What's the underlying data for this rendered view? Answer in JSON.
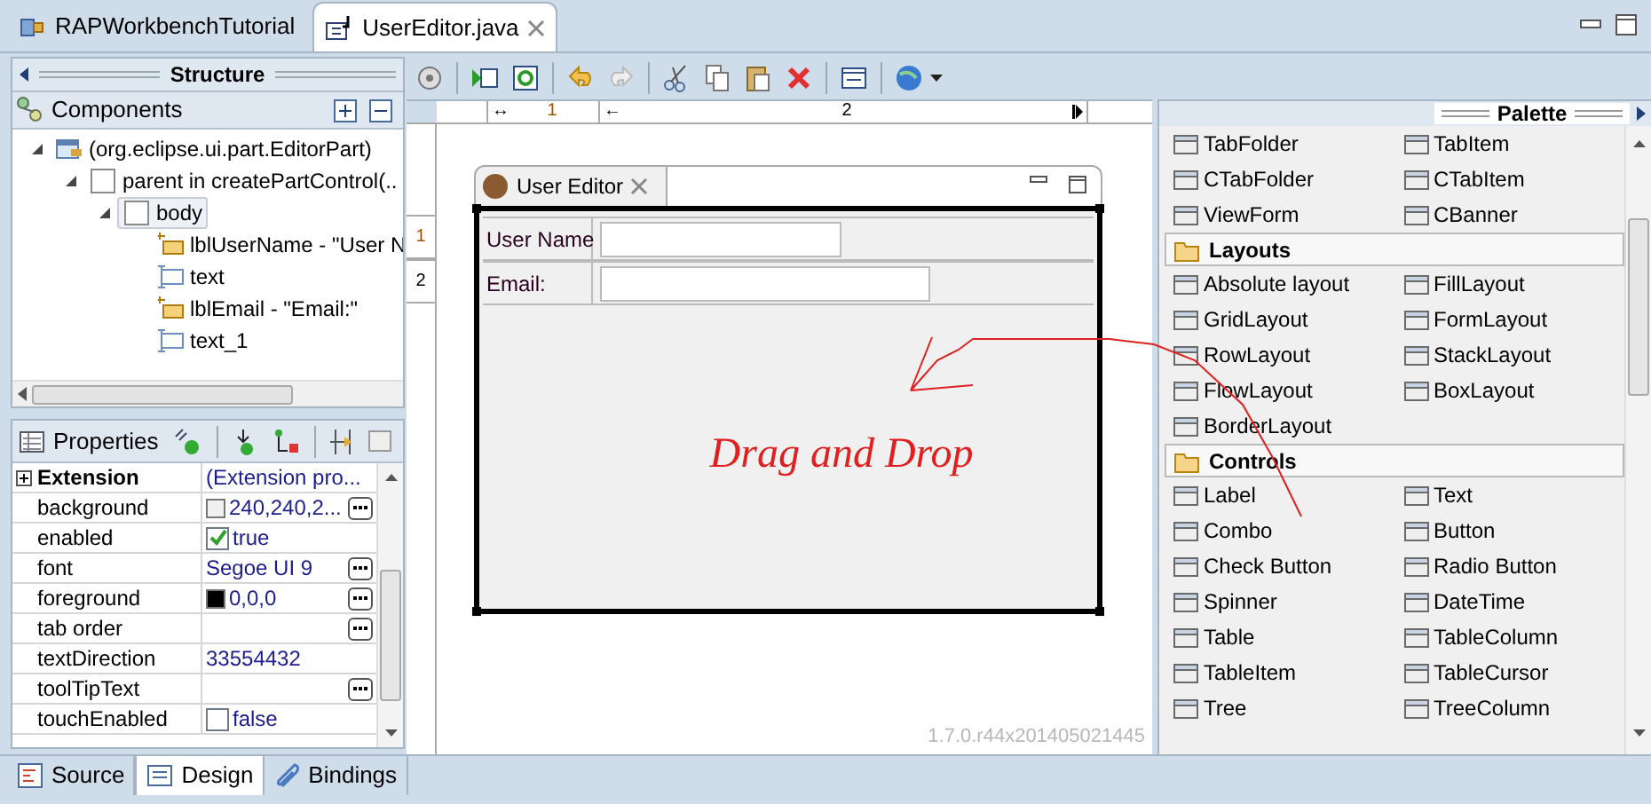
{
  "editor_tabs": [
    {
      "label": "RAPWorkbenchTutorial",
      "selected": false
    },
    {
      "label": "UserEditor.java",
      "selected": true
    }
  ],
  "structure": {
    "title": "Structure"
  },
  "components": {
    "title": "Components",
    "tree": [
      {
        "label": "(org.eclipse.ui.part.EditorPart)",
        "kind": "part",
        "expanded": true,
        "selected": false,
        "children": [
          {
            "label": "parent in createPartControl(..",
            "kind": "composite",
            "expanded": true,
            "selected": false,
            "children": [
              {
                "label": "body",
                "kind": "composite",
                "expanded": true,
                "selected": true,
                "children": [
                  {
                    "label": "lblUserName - \"User N",
                    "kind": "label",
                    "selected": false
                  },
                  {
                    "label": "text",
                    "kind": "text",
                    "selected": false
                  },
                  {
                    "label": "lblEmail - \"Email:\"",
                    "kind": "label",
                    "selected": false
                  },
                  {
                    "label": "text_1",
                    "kind": "text",
                    "selected": false
                  }
                ]
              }
            ]
          }
        ]
      }
    ]
  },
  "properties": {
    "title": "Properties",
    "rows": [
      {
        "name": "Extension",
        "kind": "category",
        "expanded": false,
        "value": "(Extension pro..."
      },
      {
        "name": "background",
        "kind": "color",
        "color": "#f0f0f0",
        "value": "240,240,2...",
        "button": true
      },
      {
        "name": "enabled",
        "kind": "check",
        "checked": true,
        "value": "true"
      },
      {
        "name": "font",
        "kind": "text",
        "value": "Segoe UI 9",
        "button": true
      },
      {
        "name": "foreground",
        "kind": "color",
        "color": "#000000",
        "value": "0,0,0",
        "button": true
      },
      {
        "name": "tab order",
        "kind": "text",
        "button": true
      },
      {
        "name": "textDirection",
        "kind": "text",
        "value": "33554432"
      },
      {
        "name": "toolTipText",
        "kind": "text",
        "button": true
      },
      {
        "name": "touchEnabled",
        "kind": "check",
        "checked": false,
        "value": "false"
      }
    ]
  },
  "ruler": {
    "columns": [
      {
        "label": "1",
        "glyph": "↔"
      },
      {
        "label": "2",
        "glyph": "←"
      }
    ],
    "rows": [
      "1",
      "2"
    ]
  },
  "form": {
    "title": "User Editor",
    "fields": [
      {
        "label": "User Name"
      },
      {
        "label": "Email:"
      }
    ],
    "annotation": "Drag and Drop"
  },
  "version": "1.7.0.r44x201405021445",
  "palette": {
    "title": "Palette",
    "groups": [
      {
        "items": [
          "TabFolder",
          "TabItem",
          "CTabFolder",
          "CTabItem",
          "ViewForm",
          "CBanner"
        ]
      },
      {
        "title": "Layouts",
        "items": [
          "Absolute layout",
          "FillLayout",
          "GridLayout",
          "FormLayout",
          "RowLayout",
          "StackLayout",
          "FlowLayout",
          "BoxLayout",
          "BorderLayout"
        ]
      },
      {
        "title": "Controls",
        "items": [
          "Label",
          "Text",
          "Combo",
          "Button",
          "Check Button",
          "Radio Button",
          "Spinner",
          "DateTime",
          "Table",
          "TableColumn",
          "TableItem",
          "TableCursor",
          "Tree",
          "TreeColumn"
        ]
      }
    ]
  },
  "bottom_tabs": [
    {
      "label": "Source",
      "selected": false
    },
    {
      "label": "Design",
      "selected": true
    },
    {
      "label": "Bindings",
      "selected": false
    }
  ]
}
